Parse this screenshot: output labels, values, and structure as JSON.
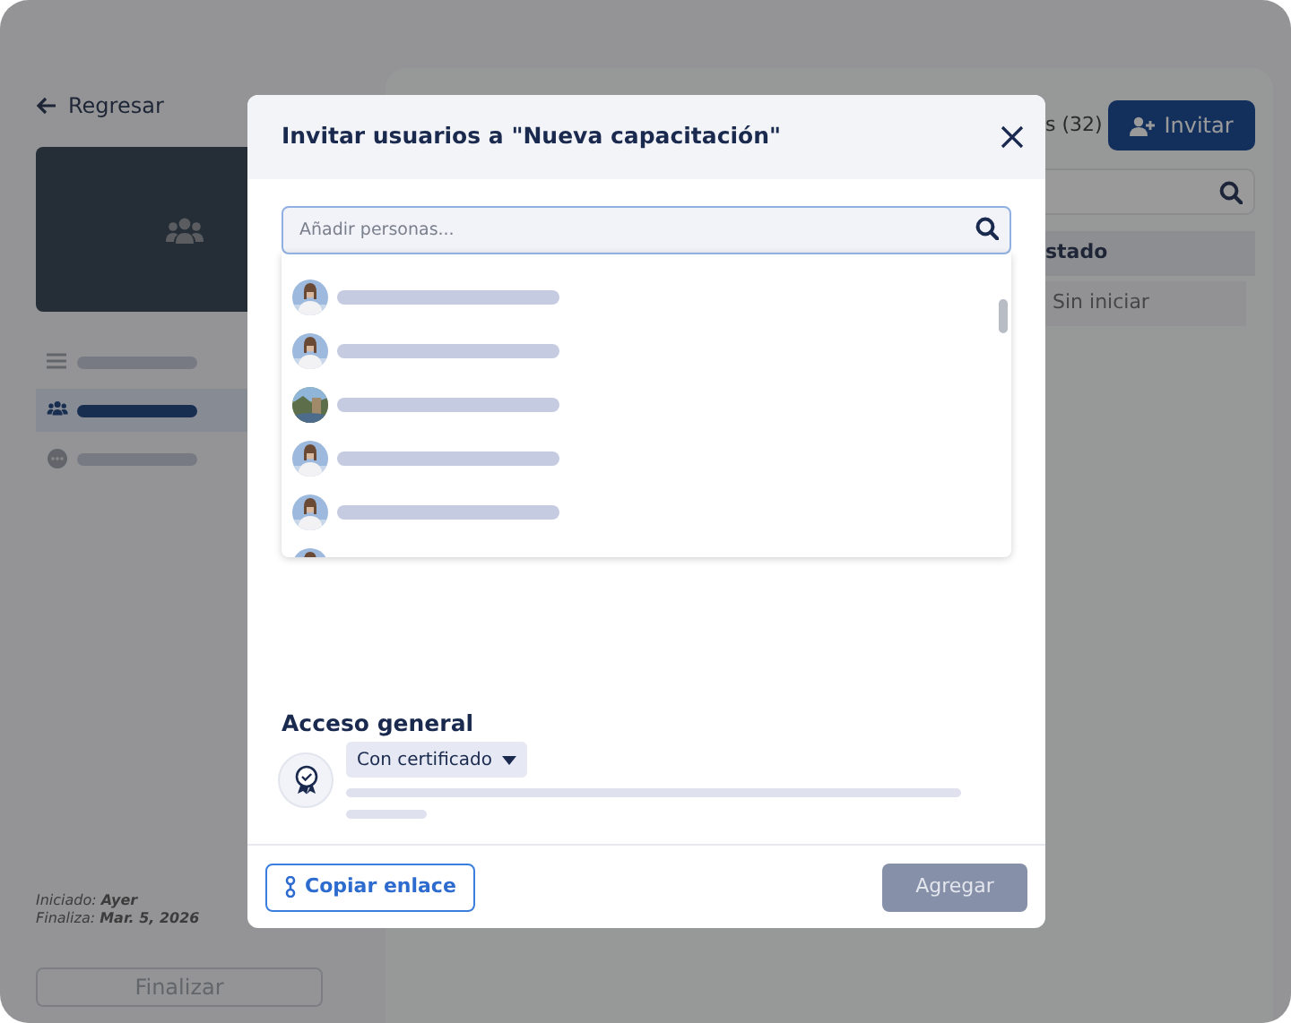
{
  "back_link": "Regresar",
  "sidebar": {
    "items": [
      {
        "kind": "list",
        "selected": false
      },
      {
        "kind": "users",
        "selected": true
      },
      {
        "kind": "chat",
        "selected": false
      }
    ]
  },
  "dates": [
    "Iniciado: **Ayer**",
    "Finaliza: **Mar. 5, 2026**"
  ],
  "finish_button": {
    "label": "Finalizar",
    "disabled": true
  },
  "tab_fragment": "s (32)",
  "invite_button": "Invitar",
  "table": {
    "column_fragment": "stado",
    "cell": "Sin iniciar"
  },
  "modal": {
    "title": "Invitar usuarios a \"Nueva capacitación\"",
    "search": {
      "placeholder": "Añadir personas..."
    },
    "people": [
      {
        "kind": "person",
        "cut_off": false
      },
      {
        "kind": "person",
        "cut_off": false
      },
      {
        "kind": "landscape",
        "cut_off": false
      },
      {
        "kind": "person",
        "cut_off": false
      },
      {
        "kind": "person",
        "cut_off": false
      },
      {
        "kind": "person",
        "cut_off": true
      }
    ],
    "access": {
      "heading": "Acceso general",
      "option": "Con certificado"
    },
    "copy_button": "Copiar enlace",
    "add_button": {
      "label": "Agregar",
      "disabled": true
    }
  }
}
